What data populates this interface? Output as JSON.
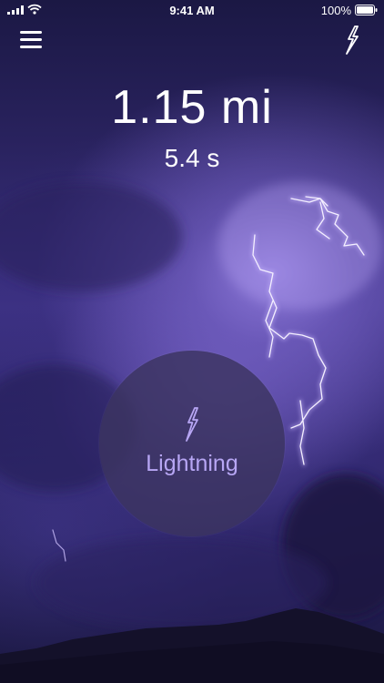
{
  "status_bar": {
    "time": "9:41 AM",
    "battery_percent": "100%",
    "icons": [
      "signal-icon",
      "wifi-icon",
      "battery-icon"
    ]
  },
  "header": {
    "menu_icon": "hamburger-menu-icon",
    "bolt_icon": "lightning-bolt-icon"
  },
  "readout": {
    "distance": "1.15 mi",
    "time": "5.4 s"
  },
  "lightning_button": {
    "icon": "lightning-bolt-icon",
    "label": "Lightning"
  },
  "colors": {
    "accent": "#b7a6f4",
    "text": "#ffffff",
    "button_bg": "#3c3460"
  }
}
